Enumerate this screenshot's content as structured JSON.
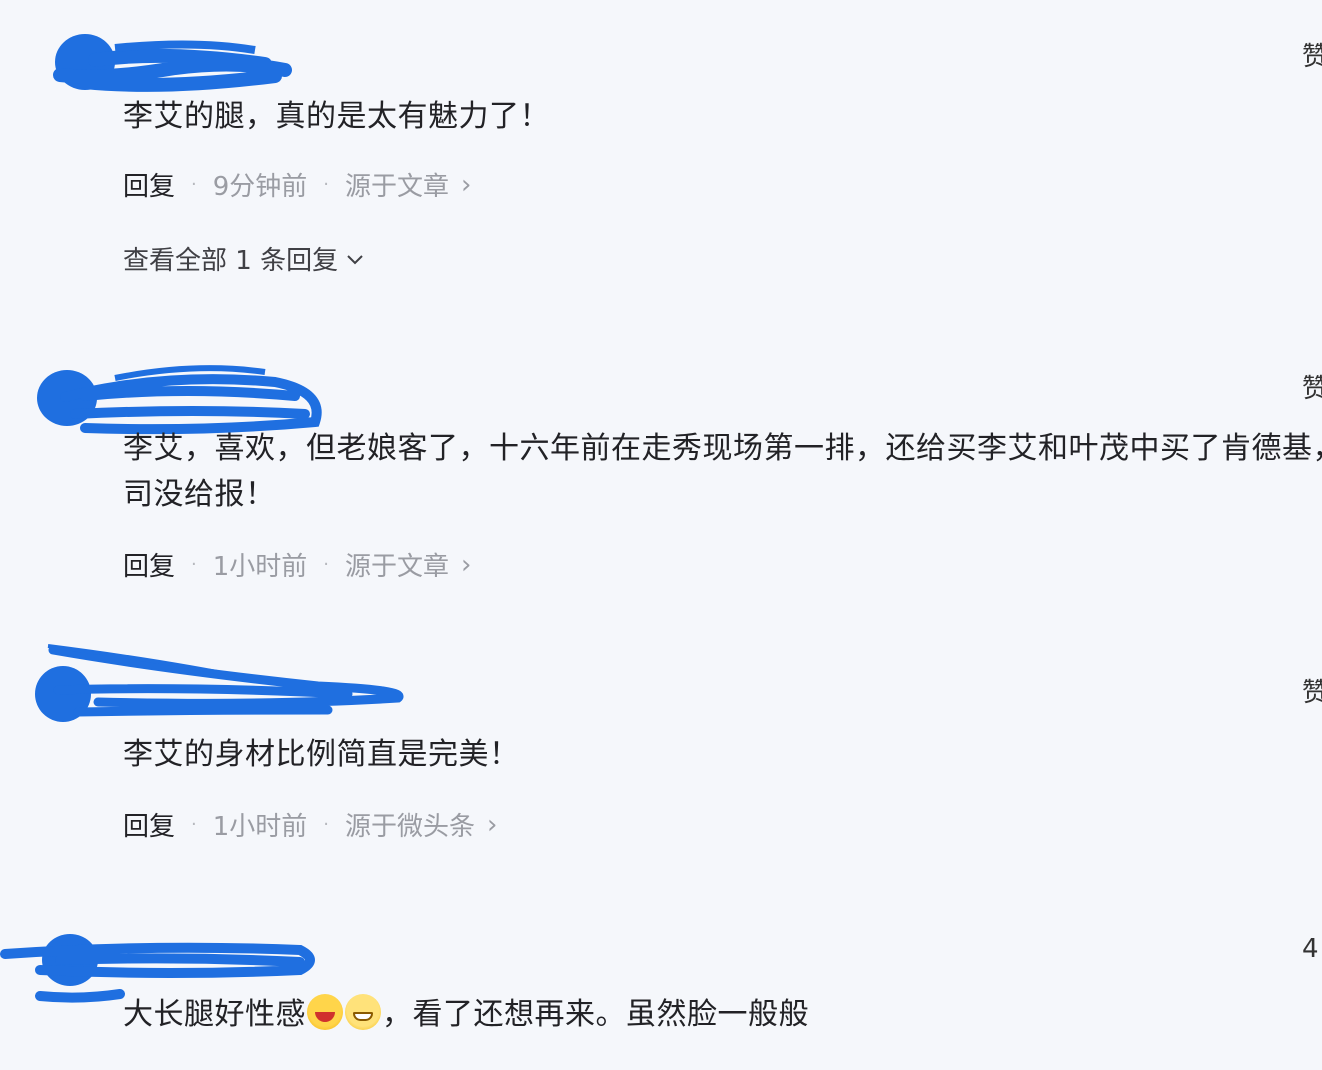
{
  "comments": [
    {
      "text": "李艾的腿，真的是太有魅力了！",
      "reply_label": "回复",
      "time": "9分钟前",
      "source": "源于文章",
      "like": "赞",
      "more_replies": "查看全部 1 条回复"
    },
    {
      "text": "李艾，喜欢，但老娘客了，十六年前在走秀现场第一排，还给买李艾和叶茂中买了肯德基，公司没给报！",
      "reply_label": "回复",
      "time": "1小时前",
      "source": "源于文章",
      "like": "赞"
    },
    {
      "text": "李艾的身材比例简直是完美！",
      "reply_label": "回复",
      "time": "1小时前",
      "source": "源于微头条",
      "like": "赞"
    },
    {
      "text_before_emoji": "大长腿好性感",
      "text_after_emoji": "，看了还想再来。虽然脸一般般",
      "like": "4"
    }
  ],
  "icons": {
    "chevron_right": "chevron-right-icon",
    "chevron_down": "chevron-down-icon",
    "emoji_1": "laughing-emoji-icon",
    "emoji_2": "grinning-emoji-icon"
  },
  "colors": {
    "scribble": "#1f6fe0",
    "background": "#f5f7fb",
    "meta": "#9a9ca3"
  }
}
